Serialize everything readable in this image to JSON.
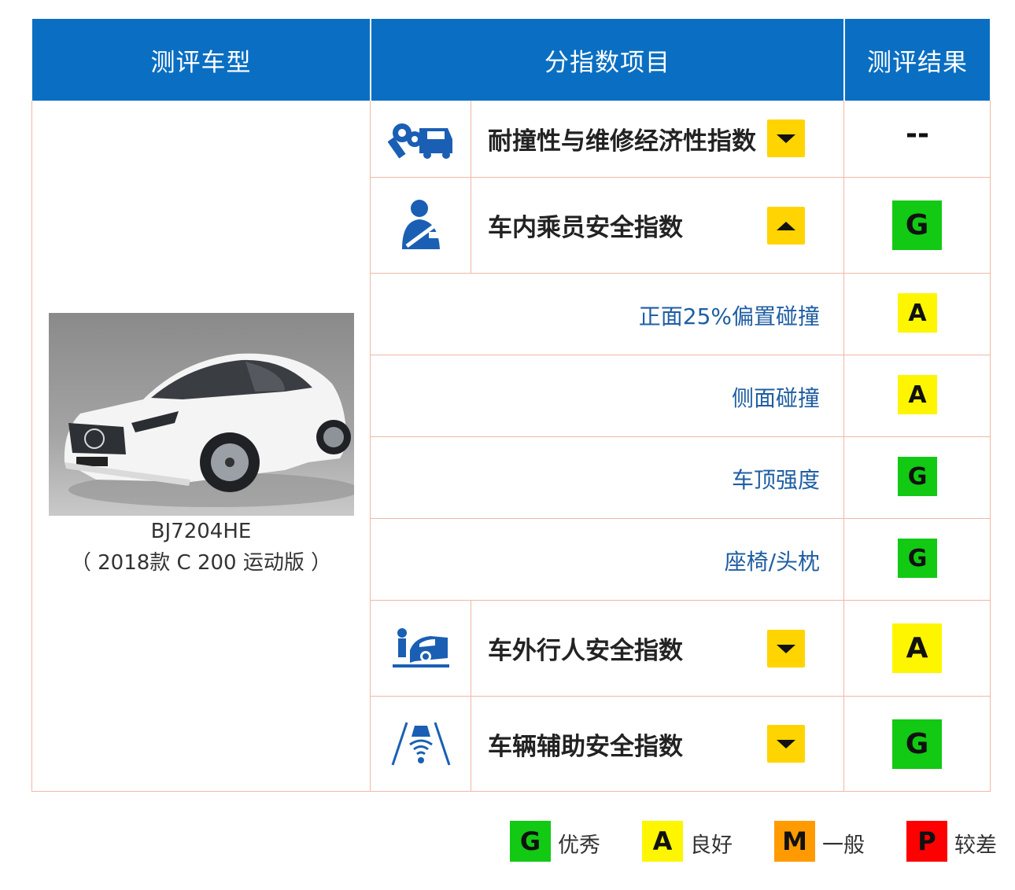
{
  "header": {
    "col1": "测评车型",
    "col2": "分指数项目",
    "col3": "测评结果"
  },
  "car": {
    "model_code": "BJ7204HE",
    "model_desc": "（ 2018款 C 200 运动版 ）"
  },
  "indices": [
    {
      "icon": "wrench-car-icon",
      "label": "耐撞性与维修经济性指数",
      "arrow": "down",
      "result": "--"
    },
    {
      "icon": "seatbelt-occupant-icon",
      "label": "车内乘员安全指数",
      "arrow": "up",
      "result": "G"
    },
    {
      "icon": "pedestrian-car-icon",
      "label": "车外行人安全指数",
      "arrow": "down",
      "result": "A"
    },
    {
      "icon": "driver-assist-icon",
      "label": "车辆辅助安全指数",
      "arrow": "down",
      "result": "G"
    }
  ],
  "sub_items": [
    {
      "label": "正面25%偏置碰撞",
      "result": "A"
    },
    {
      "label": "侧面碰撞",
      "result": "A"
    },
    {
      "label": "车顶强度",
      "result": "G"
    },
    {
      "label": "座椅/头枕",
      "result": "G"
    }
  ],
  "legend": [
    {
      "code": "G",
      "text": "优秀",
      "color": "#12c914"
    },
    {
      "code": "A",
      "text": "良好",
      "color": "#fef500"
    },
    {
      "code": "M",
      "text": "一般",
      "color": "#ff9a00"
    },
    {
      "code": "P",
      "text": "较差",
      "color": "#ff0000"
    }
  ],
  "colors": {
    "header_bg": "#0a6fc2",
    "icon_blue": "#1a5fb4",
    "arrow_yellow": "#ffd400",
    "grid_line": "#f0b8a6",
    "sub_label": "#1f5ea3"
  }
}
